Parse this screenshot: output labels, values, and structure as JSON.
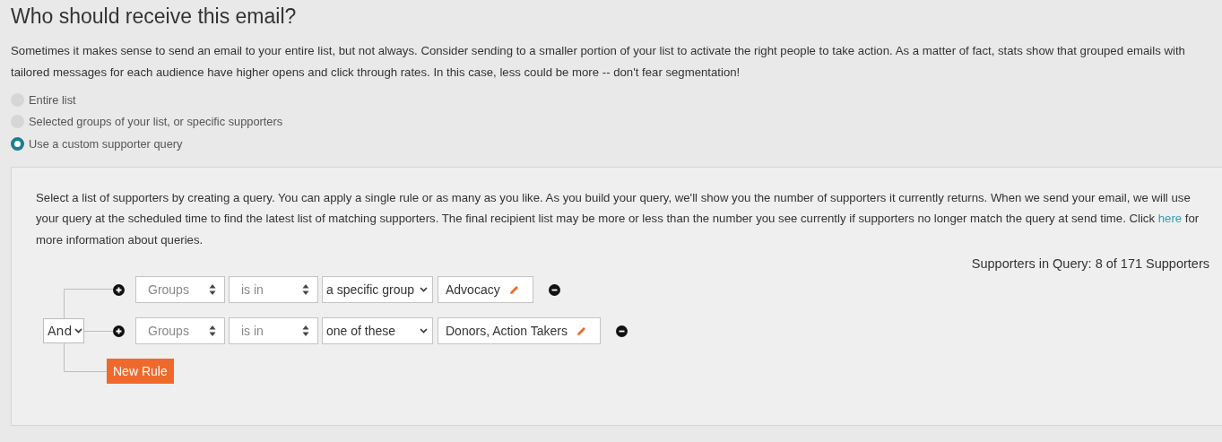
{
  "heading": "Who should receive this email?",
  "intro": "Sometimes it makes sense to send an email to your entire list, but not always. Consider sending to a smaller portion of your list to activate the right people to take action. As a matter of fact, stats show that grouped emails with tailored messages for each audience have higher opens and click through rates. In this case, less could be more -- don't fear segmentation!",
  "options": [
    {
      "label": "Entire list",
      "selected": false
    },
    {
      "label": "Selected groups of your list, or specific supporters",
      "selected": false
    },
    {
      "label": "Use a custom supporter query",
      "selected": true
    }
  ],
  "query": {
    "description_before": "Select a list of supporters by creating a query. You can apply a single rule or as many as you like. As you build your query, we'll show you the number of supporters it currently returns. When we send your email, we will use your query at the scheduled time to find the latest list of matching supporters. The final recipient list may be more or less than the number you see currently if supporters no longer match the query at send time. Click",
    "link": "here",
    "description_after": "for more information about queries.",
    "count": "Supporters in Query: 8 of 171 Supporters",
    "combinator": "And",
    "rules": [
      {
        "field": "Groups",
        "operator": "is in",
        "value": "a specific group",
        "tag": "Advocacy"
      },
      {
        "field": "Groups",
        "operator": "is in",
        "value": "one of these",
        "tag": "Donors, Action Takers"
      }
    ],
    "new_rule": "New Rule"
  }
}
